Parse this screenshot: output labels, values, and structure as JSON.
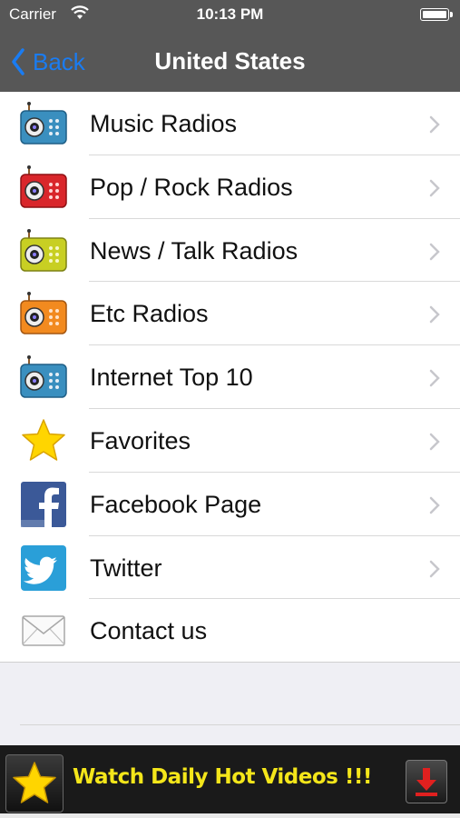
{
  "status_bar": {
    "carrier": "Carrier",
    "time": "10:13 PM"
  },
  "nav": {
    "back_label": "Back",
    "title": "United States"
  },
  "menu": [
    {
      "label": "Music Radios",
      "icon": "blue-radio-icon",
      "chevron": true
    },
    {
      "label": "Pop / Rock Radios",
      "icon": "red-radio-icon",
      "chevron": true
    },
    {
      "label": "News / Talk Radios",
      "icon": "yellow-radio-icon",
      "chevron": true
    },
    {
      "label": "Etc Radios",
      "icon": "orange-radio-icon",
      "chevron": true
    },
    {
      "label": "Internet Top 10",
      "icon": "teal-radio-icon",
      "chevron": true
    },
    {
      "label": "Favorites",
      "icon": "star-icon",
      "chevron": true
    },
    {
      "label": "Facebook Page",
      "icon": "facebook-icon",
      "chevron": true
    },
    {
      "label": "Twitter",
      "icon": "twitter-icon",
      "chevron": true
    },
    {
      "label": "Contact us",
      "icon": "envelope-icon",
      "chevron": false
    }
  ],
  "ad": {
    "text": "Watch Daily Hot Videos !!!",
    "icons": [
      "star-icon",
      "download-icon"
    ]
  },
  "colors": {
    "nav_bg": "#575757",
    "accent": "#1a7cf2",
    "ad_text": "#f4e61a",
    "ad_bg": "#1a1a1a"
  }
}
